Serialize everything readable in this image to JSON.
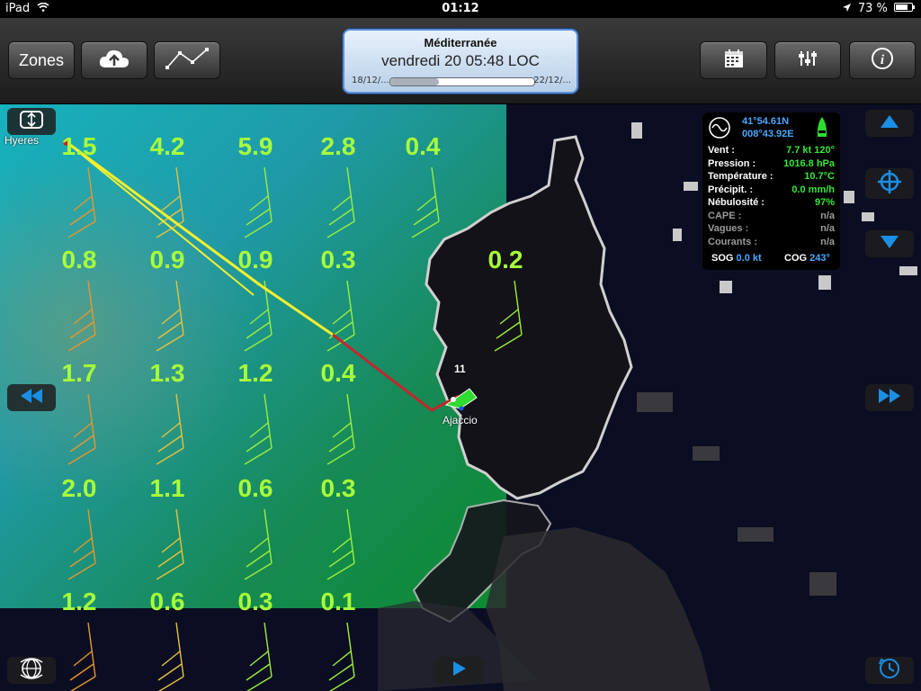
{
  "status": {
    "device": "iPad",
    "time": "01:12",
    "battery": "73 %"
  },
  "toolbar": {
    "zones_label": "Zones",
    "panel_title": "Méditerranée",
    "panel_date": "vendredi 20 05:48 LOC",
    "range_start": "18/12/...",
    "range_end": "22/12/...",
    "timeline_progress": 0.34
  },
  "map": {
    "labels": {
      "start": "Hyeres",
      "end": "Ajaccio",
      "current": "11"
    },
    "wind_values": [
      [
        "1.5",
        "4.2",
        "5.9",
        "2.8",
        "0.4"
      ],
      [
        "0.8",
        "0.9",
        "0.9",
        "0.3",
        "0.2"
      ],
      [
        "1.7",
        "1.3",
        "1.2",
        "0.4"
      ],
      [
        "2.0",
        "1.1",
        "0.6",
        "0.3"
      ],
      [
        "1.2",
        "0.6",
        "0.3",
        "0.1"
      ]
    ]
  },
  "info": {
    "lat": "41°54.61N",
    "lon": "008°43.92E",
    "rows": [
      {
        "label": "Vent :",
        "value": "7.7 kt 120°",
        "available": true
      },
      {
        "label": "Pression :",
        "value": "1016.8 hPa",
        "available": true
      },
      {
        "label": "Température :",
        "value": "10.7°C",
        "available": true
      },
      {
        "label": "Précipit. :",
        "value": "0.0 mm/h",
        "available": true
      },
      {
        "label": "Nébulosité :",
        "value": "97%",
        "available": true
      },
      {
        "label": "CAPE :",
        "value": "n/a",
        "available": false
      },
      {
        "label": "Vagues :",
        "value": "n/a",
        "available": false
      },
      {
        "label": "Courants :",
        "value": "n/a",
        "available": false
      }
    ],
    "sog_label": "SOG",
    "sog_value": "0.0 kt",
    "cog_label": "COG",
    "cog_value": "243°"
  },
  "colors": {
    "wind_text": "#a8ff3a",
    "route": "#f2ef2e",
    "route_red": "#c2272d",
    "accent_blue": "#1a8fe6",
    "info_green": "#33e838"
  },
  "icons": [
    "wifi-icon",
    "location-icon",
    "battery-icon",
    "cloud-upload-icon",
    "route-icon",
    "calendar-icon",
    "sliders-icon",
    "info-icon",
    "chart-wave-icon",
    "boat-icon",
    "arrow-up-icon",
    "crosshair-icon",
    "arrow-down-icon",
    "rewind-icon",
    "fast-forward-icon",
    "play-icon",
    "globe-rotate-icon",
    "clock-icon",
    "layers-icon"
  ]
}
